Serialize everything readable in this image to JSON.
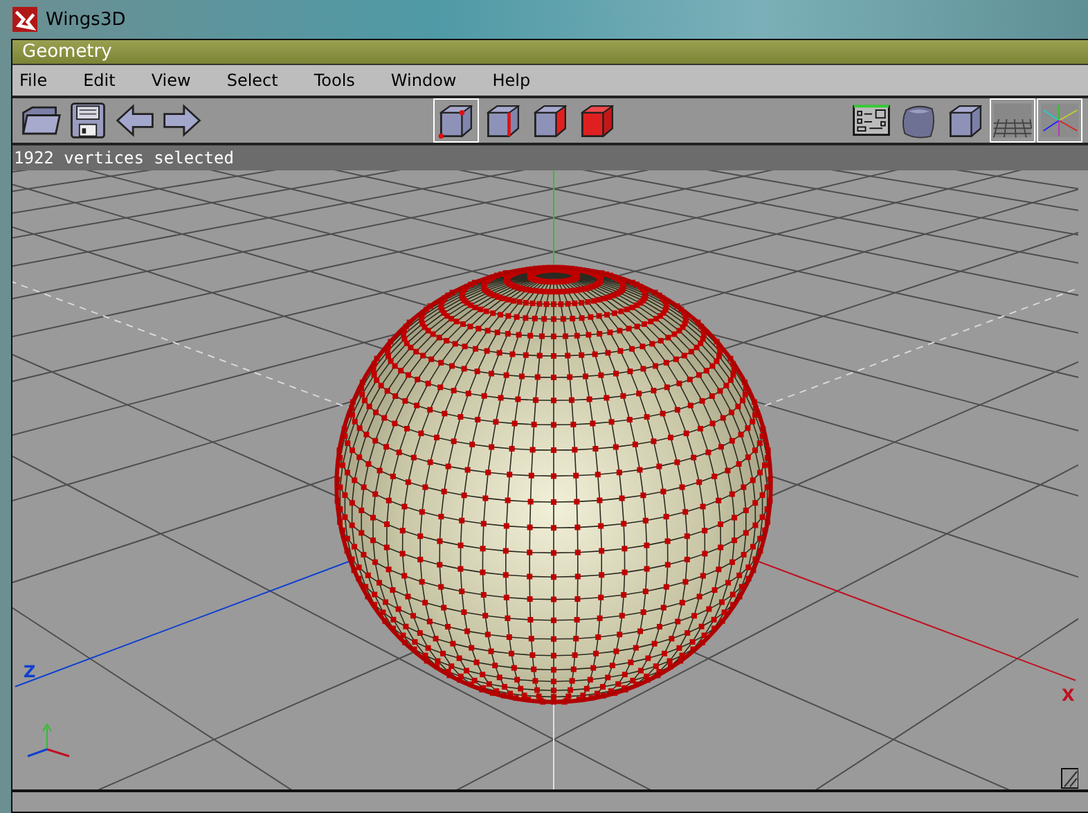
{
  "window": {
    "title": "Wings3D"
  },
  "panel": {
    "title": "Geometry"
  },
  "menu": [
    "File",
    "Edit",
    "View",
    "Select",
    "Tools",
    "Window",
    "Help"
  ],
  "toolbar_left": [
    {
      "kind": "open"
    },
    {
      "kind": "save"
    },
    {
      "kind": "undo"
    },
    {
      "kind": "redo"
    }
  ],
  "selection_modes": [
    {
      "kind": "vertex",
      "selected": true
    },
    {
      "kind": "edge",
      "selected": false
    },
    {
      "kind": "face",
      "selected": false
    },
    {
      "kind": "body",
      "selected": false
    }
  ],
  "toolbar_right": [
    {
      "kind": "panel",
      "on": false
    },
    {
      "kind": "smooth",
      "on": false
    },
    {
      "kind": "ortho",
      "on": false
    },
    {
      "kind": "ground",
      "on": true
    },
    {
      "kind": "axes",
      "on": true
    }
  ],
  "status": "1922 vertices selected",
  "viewport": {
    "axis_labels": [
      {
        "kind": "z",
        "text": "Z"
      },
      {
        "kind": "x",
        "text": "X"
      }
    ]
  }
}
